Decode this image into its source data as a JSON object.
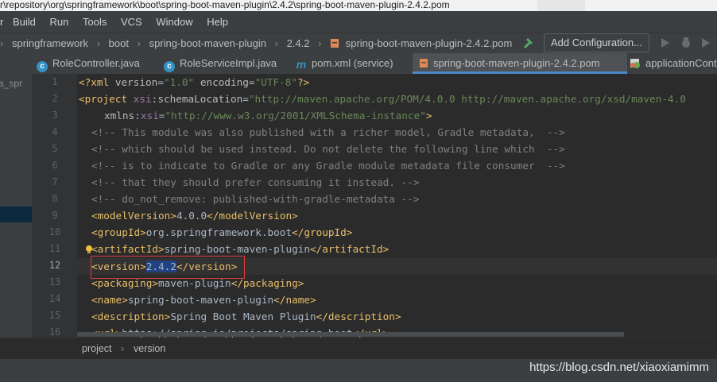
{
  "window": {
    "title": "r\\repository\\org\\springframework\\boot\\spring-boot-maven-plugin\\2.4.2\\spring-boot-maven-plugin-2.4.2.pom"
  },
  "menu": [
    "Build",
    "Run",
    "Tools",
    "VCS",
    "Window",
    "Help"
  ],
  "menu_lead": "r",
  "breadcrumbs": [
    "springframework",
    "boot",
    "spring-boot-maven-plugin",
    "2.4.2",
    "spring-boot-maven-plugin-2.4.2.pom"
  ],
  "toolbar": {
    "add_configuration": "Add Configuration..."
  },
  "tabs": [
    {
      "label": "RoleController.java",
      "icon": "class-icon",
      "icon_char": "c"
    },
    {
      "label": "RoleServiceImpl.java",
      "icon": "class-icon",
      "icon_char": "c"
    },
    {
      "label": "pom.xml (service)",
      "icon": "maven-icon",
      "icon_char": "m"
    },
    {
      "label": "spring-boot-maven-plugin-2.4.2.pom",
      "icon": "pom-file-icon",
      "icon_char": ""
    },
    {
      "label": "applicationCont",
      "icon": "spring-config-icon",
      "icon_char": ""
    }
  ],
  "project_panel": {
    "partial_label": "a_spr"
  },
  "line_numbers": [
    "1",
    "2",
    "3",
    "4",
    "5",
    "6",
    "7",
    "8",
    "9",
    "10",
    "11",
    "12",
    "13",
    "14",
    "15",
    "16"
  ],
  "current_line": "12",
  "code": {
    "l1": {
      "open": "<?xml ",
      "a1": "version",
      "eq1": "=",
      "v1": "\"1.0\"",
      "sp": " ",
      "a2": "encoding",
      "eq2": "=",
      "v2": "\"UTF-8\"",
      "close": "?>"
    },
    "l2": {
      "open": "<project ",
      "ns": "xsi",
      "colon": ":",
      "attr": "schemaLocation",
      "eq": "=",
      "val": "\"http://maven.apache.org/POM/4.0.0 http://maven.apache.org/xsd/maven-4.0"
    },
    "l3": {
      "attr": "xmlns",
      "colon": ":",
      "ns": "xsi",
      "eq": "=",
      "val": "\"http://www.w3.org/2001/XMLSchema-instance\"",
      "close": ">"
    },
    "l4": "<!-- This module was also published with a richer model, Gradle metadata,  -->",
    "l5": "<!-- which should be used instead. Do not delete the following line which  -->",
    "l6": "<!-- is to indicate to Gradle or any Gradle module metadata file consumer  -->",
    "l7": "<!-- that they should prefer consuming it instead. -->",
    "l8": "<!-- do_not_remove: published-with-gradle-metadata -->",
    "l9": {
      "o": "<modelVersion>",
      "t": "4.0.0",
      "c": "</modelVersion>"
    },
    "l10": {
      "o": "<groupId>",
      "t": "org.springframework.boot",
      "c": "</groupId>"
    },
    "l11": {
      "o": "<artifactId>",
      "t": "spring-boot-maven-plugin",
      "c": "</artifactId>"
    },
    "l12": {
      "o": "<version>",
      "t": "2.4.2",
      "c": "</version>"
    },
    "l13": {
      "o": "<packaging>",
      "t": "maven-plugin",
      "c": "</packaging>"
    },
    "l14": {
      "o": "<name>",
      "t": "spring-boot-maven-plugin",
      "c": "</name>"
    },
    "l15": {
      "o": "<description>",
      "t": "Spring Boot Maven Plugin",
      "c": "</description>"
    },
    "l16": {
      "o": "<url>",
      "t": "https://spring.io/projects/spring-boot",
      "c": "</url>"
    }
  },
  "structure_breadcrumb": {
    "parent": "project",
    "separator": "›",
    "child": "version"
  },
  "watermark": "https://blog.csdn.net/xiaoxiamimm",
  "colors": {
    "editor_bg": "#2b2b2b",
    "tag": "#e8bf6a",
    "string": "#6a8759",
    "comment": "#808080",
    "highlight_box": "#e03c3c",
    "selection": "#214283"
  }
}
